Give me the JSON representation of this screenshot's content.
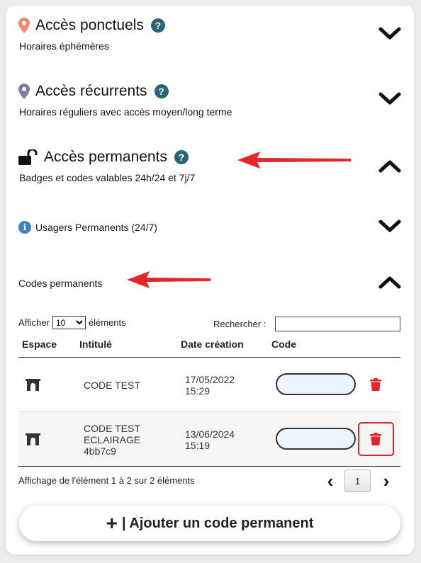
{
  "sections": [
    {
      "title": "Accès ponctuels",
      "subtitle": "Horaires éphémères",
      "help": "?",
      "icon": "map-pin-orange-icon"
    },
    {
      "title": "Accès récurrents",
      "subtitle": "Horaires réguliers avec accès moyen/long terme",
      "help": "?",
      "icon": "map-pin-purple-icon"
    },
    {
      "title": "Accès permanents",
      "subtitle": "Badges et codes valables 24h/24 et 7j/7",
      "help": "?",
      "icon": "unlock-icon"
    }
  ],
  "subsections": {
    "usagers": {
      "label": "Usagers Permanents (24/7)",
      "info": "i"
    },
    "codes": {
      "label": "Codes permanents"
    }
  },
  "table_controls": {
    "show_prefix": "Afficher",
    "page_length": "10",
    "show_suffix": "éléments",
    "search_label": "Rechercher :",
    "search_value": ""
  },
  "columns": [
    "Espace",
    "Intitulé",
    "Date création",
    "Code"
  ],
  "rows": [
    {
      "label_lines": [
        "CODE TEST"
      ],
      "date": "17/05/2022",
      "time": "15:29"
    },
    {
      "label_lines": [
        "CODE TEST",
        "ECLAIRAGE",
        "4bb7c9"
      ],
      "date": "13/06/2024",
      "time": "15:19"
    }
  ],
  "footer": {
    "info": "Affichage de l'élément 1 à 2 sur 2 éléments",
    "prev": "‹",
    "next": "›",
    "page": "1"
  },
  "add_button": {
    "plus": "+",
    "label": "| Ajouter un code permanent"
  },
  "colors": {
    "help_badge": "#2a6478",
    "pin_orange": "#f08a6a",
    "pin_purple": "#7b7fa6",
    "annotation_arrow": "#e4262b",
    "trash": "#e4262b",
    "code_field": "#eef4fb"
  }
}
